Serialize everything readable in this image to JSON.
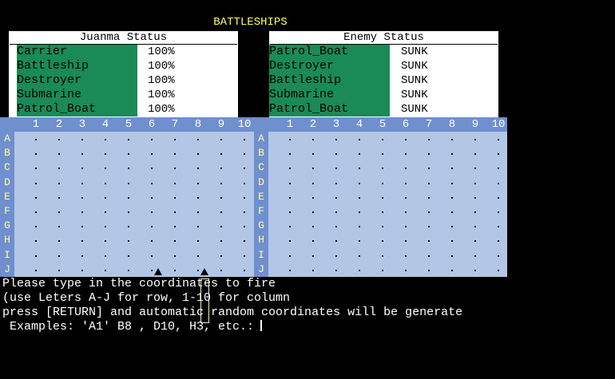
{
  "title": "BATTLESHIPS",
  "player": {
    "header": "Juanma Status",
    "ships": [
      {
        "name": "Carrier",
        "status": "100%"
      },
      {
        "name": "Battleship",
        "status": "100%"
      },
      {
        "name": "Destroyer",
        "status": "100%"
      },
      {
        "name": "Submarine",
        "status": "100%"
      },
      {
        "name": "Patrol_Boat",
        "status": "100%"
      }
    ]
  },
  "enemy": {
    "header": "Enemy Status",
    "ships": [
      {
        "name": "Patrol_Boat",
        "status": "SUNK"
      },
      {
        "name": "Destroyer",
        "status": "SUNK"
      },
      {
        "name": "Battleship",
        "status": "SUNK"
      },
      {
        "name": "Submarine",
        "status": "SUNK"
      },
      {
        "name": "Patrol_Boat",
        "status": "SUNK"
      }
    ]
  },
  "grid": {
    "columns": [
      "1",
      "2",
      "3",
      "4",
      "5",
      "6",
      "7",
      "8",
      "9",
      "10"
    ],
    "rows": [
      "A",
      "B",
      "C",
      "D",
      "E",
      "F",
      "G",
      "H",
      "I",
      "J"
    ]
  },
  "colors": {
    "title": "#ffff55",
    "ship_name_bg": "#1a8a57",
    "board_bg": "#b3c6e6",
    "header_bg": "#6f8fcf"
  },
  "console": {
    "line1": "Please type in the coordinates to fire",
    "line2": "(use Leters A-J for row, 1-10 for column",
    "line3": "press [RETURN] and automatic random coordinates will be generate",
    "line4": " Examples: 'A1' B8 , D10, H3, etc.:"
  }
}
